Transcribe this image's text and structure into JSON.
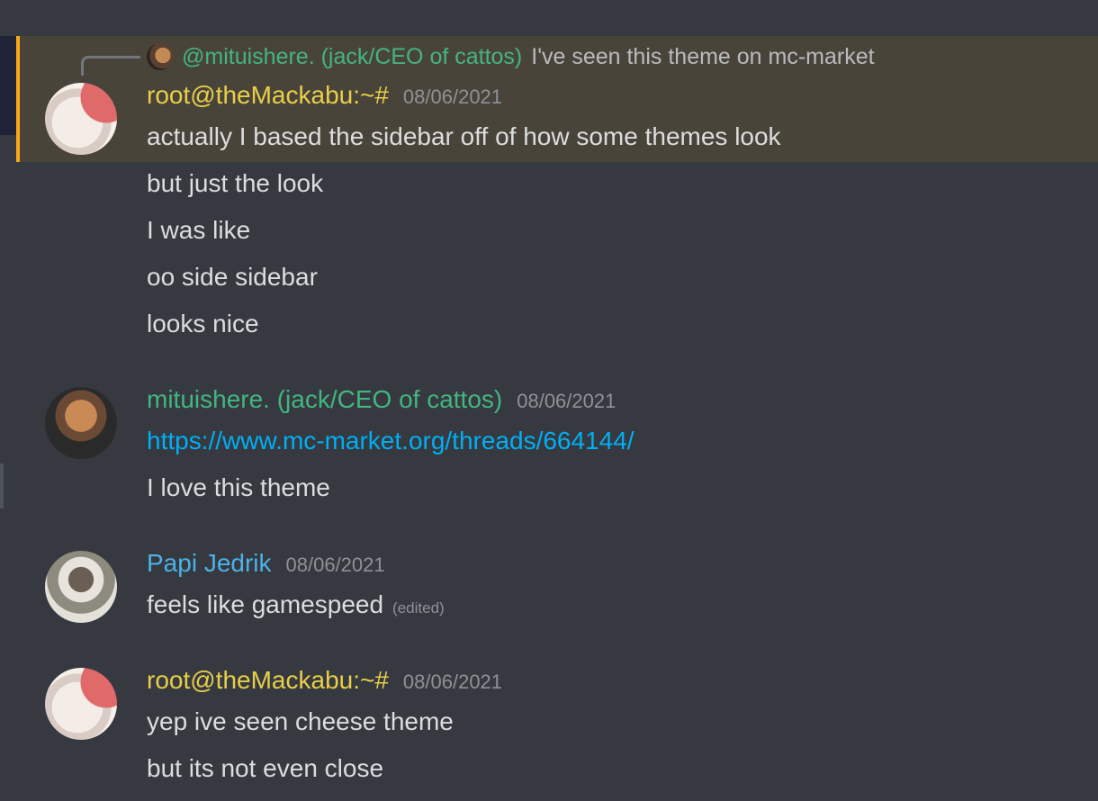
{
  "reply": {
    "name": "@mituishere. (jack/CEO of cattos)",
    "text": "I've seen this theme on mc-market"
  },
  "groups": [
    {
      "author": "root@theMackabu:~#",
      "timestamp": "08/06/2021",
      "name_color": "#e8cf4a",
      "messages": [
        "actually I based the sidebar off of how some themes look",
        "but just the look",
        "I was like",
        "oo side sidebar",
        "looks nice"
      ]
    },
    {
      "author": "mituishere. (jack/CEO of cattos)",
      "timestamp": "08/06/2021",
      "name_color": "#43b581",
      "messages": [
        "https://www.mc-market.org/threads/664144/",
        "I love this theme"
      ]
    },
    {
      "author": "Papi Jedrik",
      "timestamp": "08/06/2021",
      "name_color": "#4cb2e8",
      "messages": [
        "feels like gamespeed"
      ],
      "edited_label": "(edited)"
    },
    {
      "author": "root@theMackabu:~#",
      "timestamp": "08/06/2021",
      "name_color": "#e8cf4a",
      "messages": [
        "yep ive seen cheese theme",
        "but its not even close"
      ]
    }
  ],
  "colors": {
    "background": "#36393f",
    "highlight": "#49443a",
    "mention_bar": "#faa81a",
    "link": "#00aff4"
  },
  "icons": [
    "reply-spine-icon",
    "avatar-image"
  ]
}
